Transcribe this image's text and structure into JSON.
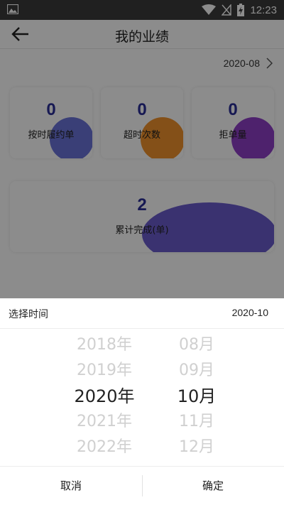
{
  "status_bar": {
    "time": "12:23"
  },
  "header": {
    "title": "我的业绩"
  },
  "current_month": "2020-08",
  "stats": [
    {
      "value": "0",
      "label": "按时履约单"
    },
    {
      "value": "0",
      "label": "超时次数"
    },
    {
      "value": "0",
      "label": "拒单量"
    }
  ],
  "total": {
    "value": "2",
    "label": "累计完成(单)"
  },
  "picker": {
    "title": "选择时间",
    "selected_value": "2020-10",
    "years": [
      "2018年",
      "2019年",
      "2020年",
      "2021年",
      "2022年"
    ],
    "months": [
      "08月",
      "09月",
      "10月",
      "11月",
      "12月"
    ],
    "selected_index": 2,
    "cancel_label": "取消",
    "confirm_label": "确定"
  },
  "colors": {
    "accent_number": "#2b2f98",
    "overlay": "rgba(0,0,0,0.45)"
  }
}
